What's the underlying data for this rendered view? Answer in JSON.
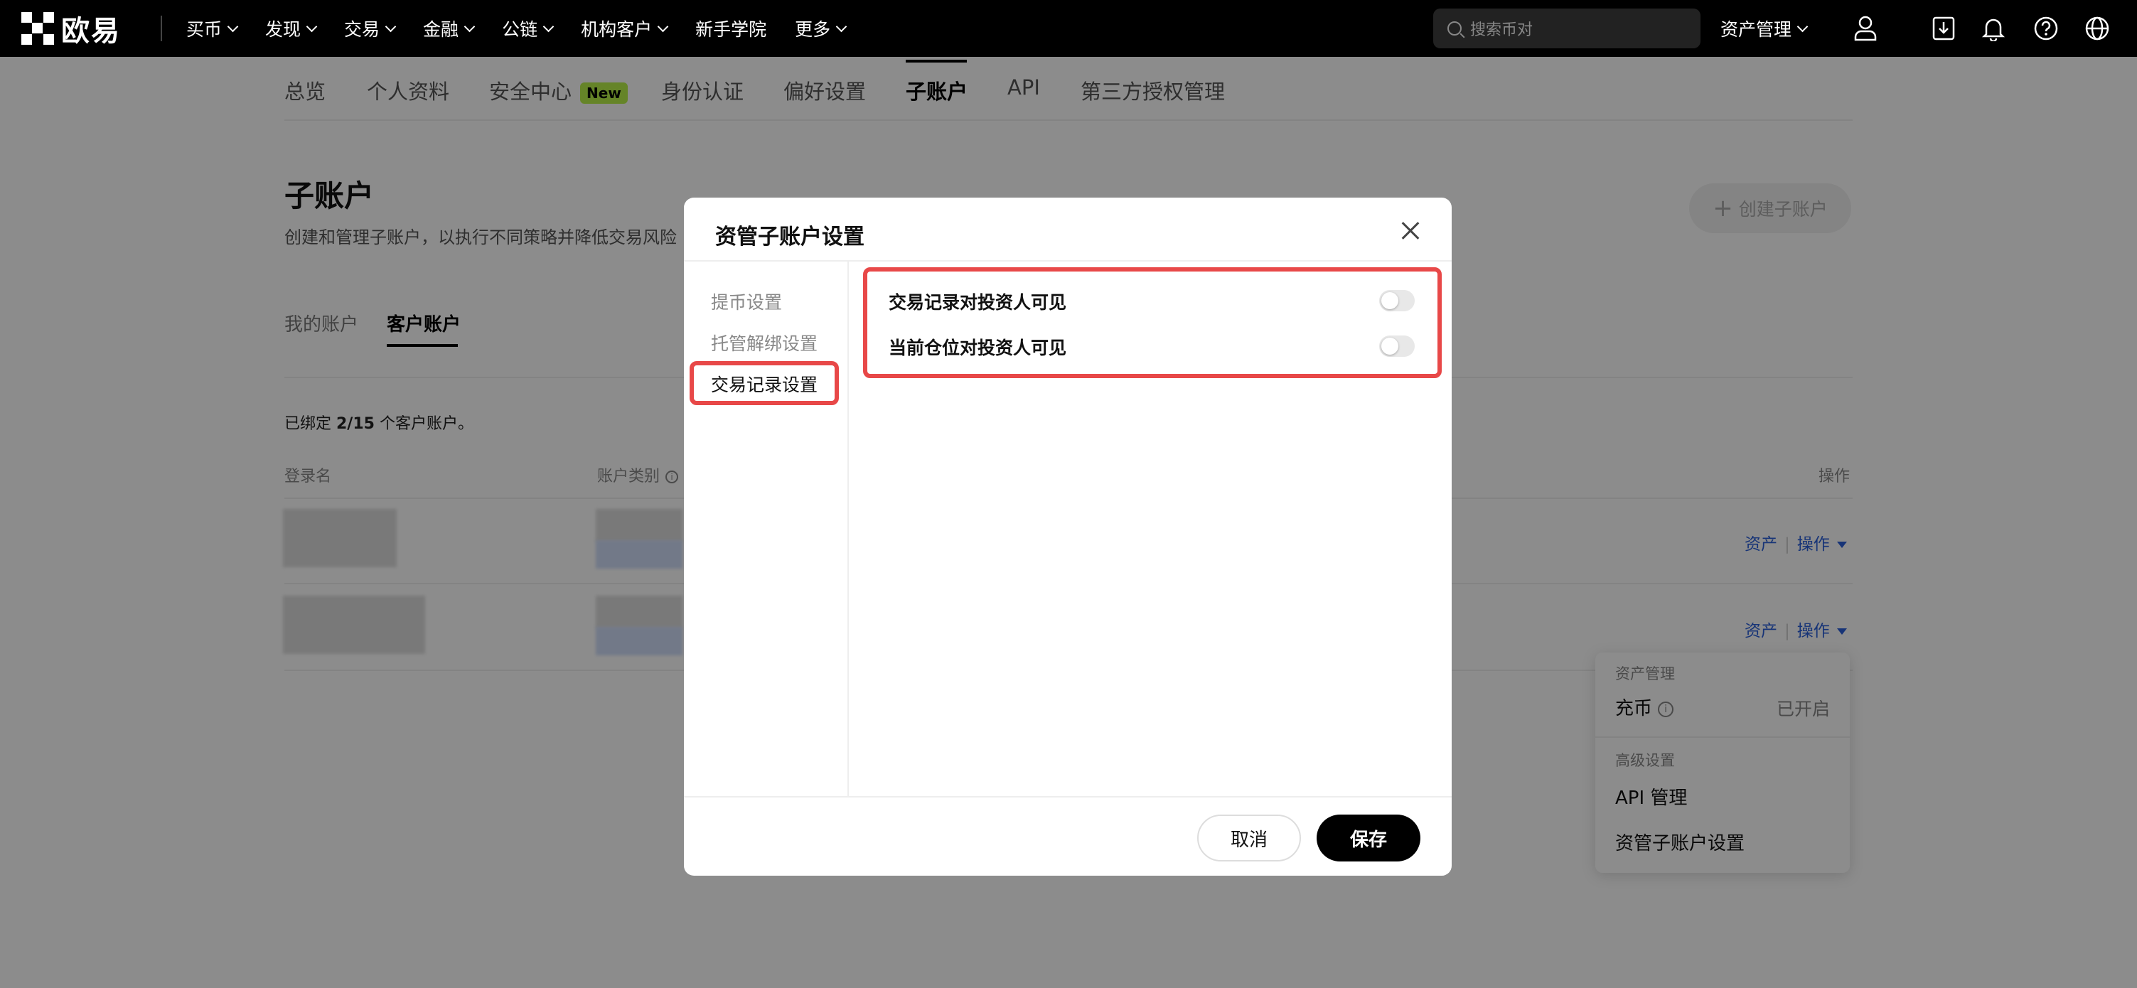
{
  "topnav": {
    "logo_text": "欧易",
    "items": [
      {
        "label": "买币",
        "has_chevron": true
      },
      {
        "label": "发现",
        "has_chevron": true
      },
      {
        "label": "交易",
        "has_chevron": true
      },
      {
        "label": "金融",
        "has_chevron": true
      },
      {
        "label": "公链",
        "has_chevron": true
      },
      {
        "label": "机构客户",
        "has_chevron": true
      },
      {
        "label": "新手学院",
        "has_chevron": false
      },
      {
        "label": "更多",
        "has_chevron": true
      }
    ],
    "search_placeholder": "搜索币对",
    "asset_management": "资产管理",
    "icons": [
      "user-icon",
      "download-icon",
      "bell-icon",
      "help-icon",
      "globe-icon"
    ]
  },
  "subnav": {
    "items": [
      "总览",
      "个人资料",
      "安全中心",
      "身份认证",
      "偏好设置",
      "子账户",
      "API",
      "第三方授权管理"
    ],
    "new_badge": "New",
    "active": "子账户"
  },
  "page": {
    "title": "子账户",
    "description": "创建和管理子账户，以执行不同策略并降低交易风险",
    "create_button": "创建子账户",
    "account_tabs": [
      "我的账户",
      "客户账户"
    ],
    "active_tab": "客户账户",
    "bind_info_prefix": "已绑定 ",
    "bind_info_count": "2/15",
    "bind_info_suffix": " 个客户账户。",
    "table_headers": {
      "login_name": "登录名",
      "account_type": "账户类别",
      "actions": "操作"
    },
    "rows": [
      {
        "asset_link": "资产",
        "action_link": "操作"
      },
      {
        "asset_link": "资产",
        "action_link": "操作"
      }
    ]
  },
  "dropdown": {
    "section_asset": "资产管理",
    "deposit_label": "充币",
    "deposit_status": "已开启",
    "section_advanced": "高级设置",
    "api_management": "API 管理",
    "managed_sub_settings": "资管子账户设置"
  },
  "modal": {
    "title": "资管子账户设置",
    "side_menu": [
      "提币设置",
      "托管解绑设置",
      "交易记录设置"
    ],
    "active_side": "交易记录设置",
    "settings": [
      {
        "label": "交易记录对投资人可见",
        "enabled": false
      },
      {
        "label": "当前仓位对投资人可见",
        "enabled": false
      }
    ],
    "cancel_label": "取消",
    "save_label": "保存"
  },
  "colors": {
    "accent_link": "#2b5fd9",
    "highlight_red": "#e84848",
    "new_badge": "#b8f04a"
  }
}
